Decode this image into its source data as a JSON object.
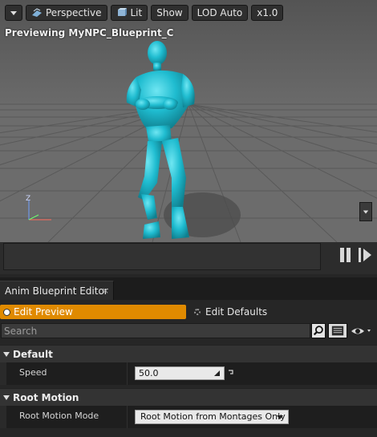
{
  "viewport": {
    "toolbar": {
      "perspective_label": "Perspective",
      "lit_label": "Lit",
      "show_label": "Show",
      "lod_label": "LOD Auto",
      "speed_label": "x1.0"
    },
    "preview_text": "Previewing MyNPC_Blueprint_C",
    "gizmo": {
      "z_label": "Z"
    }
  },
  "panel": {
    "tab_label": "Anim Blueprint Editor",
    "tab_close": "×",
    "mode": {
      "edit_preview_label": "Edit Preview",
      "edit_defaults_label": "Edit Defaults"
    },
    "search": {
      "placeholder": "Search"
    },
    "categories": [
      {
        "label": "Default",
        "properties": [
          {
            "name": "Speed",
            "value": "50.0"
          }
        ]
      },
      {
        "label": "Root Motion",
        "properties": [
          {
            "name": "Root Motion Mode",
            "value": "Root Motion from Montages Only"
          }
        ]
      }
    ]
  },
  "colors": {
    "character": "#1fbcd0",
    "active_mode": "#e08a00",
    "grid_floor": "#6c6c6c",
    "background": "#262626"
  }
}
